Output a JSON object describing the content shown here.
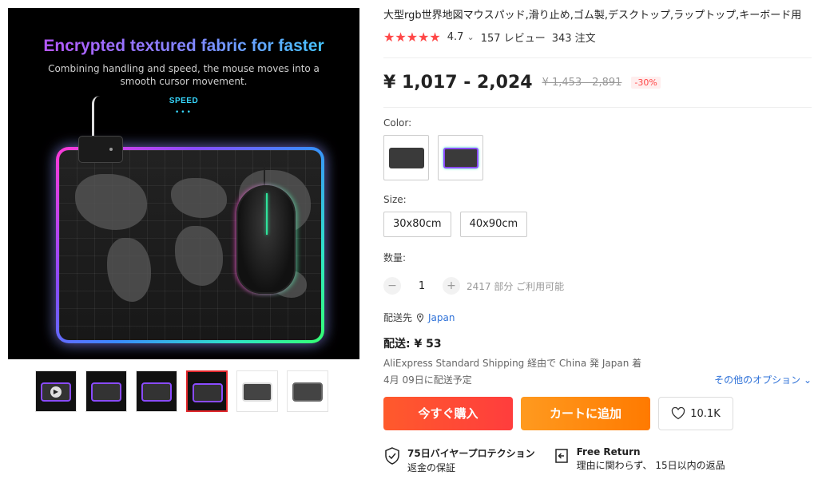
{
  "gallery": {
    "headline": "Encrypted textured fabric for faster",
    "subtext": "Combining handling and speed, the mouse moves into a smooth cursor movement.",
    "speed_label": "SPEED",
    "speed_dots": "•••"
  },
  "product": {
    "title": "大型rgb世界地図マウスパッド,滑り止め,ゴム製,デスクトップ,ラップトップ,キーボード用",
    "stars": "★★★★★",
    "rating": "4.7",
    "rating_chevron": "⌄",
    "reviews": "157 レビュー",
    "orders": "343 注文",
    "price": "¥ 1,017 - 2,024",
    "old_price": "¥ 1,453 - 2,891",
    "discount": "-30%"
  },
  "options": {
    "color_label": "Color:",
    "size_label": "Size:",
    "sizes": [
      "30x80cm",
      "40x90cm"
    ],
    "quantity_label": "数量:",
    "quantity_minus": "−",
    "quantity_plus": "+",
    "quantity": "1",
    "available": "2417 部分 ご利用可能"
  },
  "shipping": {
    "ship_to_label": "配送先",
    "ship_to_value": "Japan",
    "cost": "配送: ¥ 53",
    "detail": "AliExpress Standard Shipping 経由で China 発 Japan 着",
    "estimate": "4月 09日に配送予定",
    "other_options": "その他のオプション ⌄"
  },
  "actions": {
    "buy_now": "今すぐ購入",
    "add_to_cart": "カートに追加",
    "wishlist_count": "10.1K"
  },
  "guarantees": {
    "buyer_protection_title": "75日バイヤープロテクション",
    "buyer_protection_sub": "返金の保証",
    "free_return_title": "Free Return",
    "free_return_sub": "理由に関わらず、 15日以内の返品"
  },
  "colors": {
    "accent_red": "#ff4747",
    "buy_button": "#ff4d2e",
    "cart_button": "#ff8a10",
    "link_blue": "#2e71d8"
  }
}
